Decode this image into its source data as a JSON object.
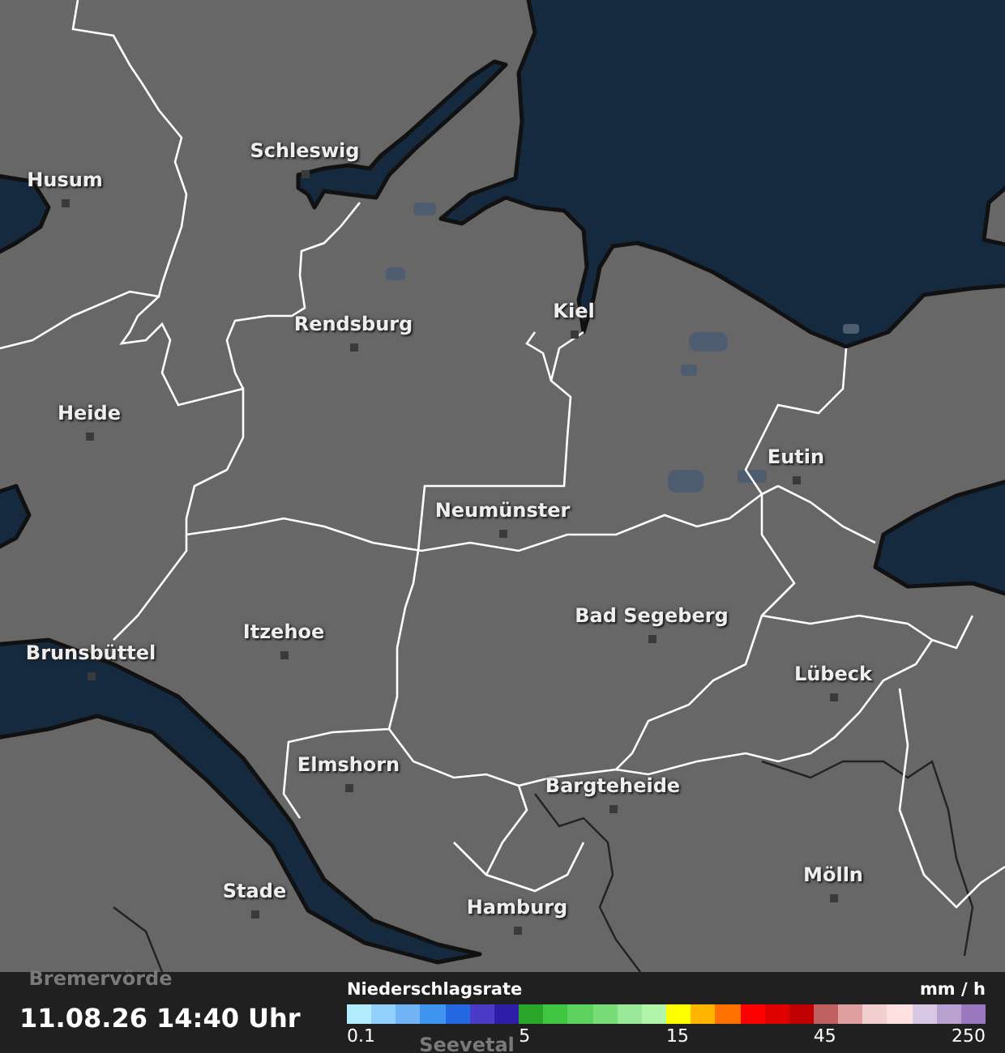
{
  "cities": [
    {
      "name": "Schleswig",
      "dimmed": false
    },
    {
      "name": "Husum",
      "dimmed": false
    },
    {
      "name": "Rendsburg",
      "dimmed": false
    },
    {
      "name": "Kiel",
      "dimmed": false
    },
    {
      "name": "Heide",
      "dimmed": false
    },
    {
      "name": "Eutin",
      "dimmed": false
    },
    {
      "name": "Neumünster",
      "dimmed": false
    },
    {
      "name": "Bad Segeberg",
      "dimmed": false
    },
    {
      "name": "Itzehoe",
      "dimmed": false
    },
    {
      "name": "Brunsbüttel",
      "dimmed": false
    },
    {
      "name": "Lübeck",
      "dimmed": false
    },
    {
      "name": "Elmshorn",
      "dimmed": false
    },
    {
      "name": "Bargteheide",
      "dimmed": false
    },
    {
      "name": "Stade",
      "dimmed": false
    },
    {
      "name": "Hamburg",
      "dimmed": false
    },
    {
      "name": "Mölln",
      "dimmed": false
    },
    {
      "name": "Bremervörde",
      "dimmed": true
    },
    {
      "name": "Seevetal",
      "dimmed": true
    }
  ],
  "timestamp": "11.08.26 14:40 Uhr",
  "legend": {
    "title": "Niederschlagsrate",
    "unit": "mm / h",
    "end_tick": "250",
    "swatches": [
      {
        "color": "#b4ecff",
        "tick": "0.1"
      },
      {
        "color": "#90d0fa"
      },
      {
        "color": "#70b4f6"
      },
      {
        "color": "#3e94ee"
      },
      {
        "color": "#2368e0"
      },
      {
        "color": "#4a3cc8"
      },
      {
        "color": "#2c1ea6"
      },
      {
        "color": "#2aa62a",
        "tick": "5"
      },
      {
        "color": "#40c640"
      },
      {
        "color": "#5ed25e"
      },
      {
        "color": "#78dc78"
      },
      {
        "color": "#98e898"
      },
      {
        "color": "#b0f5a8"
      },
      {
        "color": "#ffff00",
        "tick": "15"
      },
      {
        "color": "#ffb400"
      },
      {
        "color": "#ff7000"
      },
      {
        "color": "#ff0000"
      },
      {
        "color": "#e00000"
      },
      {
        "color": "#c00000"
      },
      {
        "color": "#c06060",
        "tick": "45"
      },
      {
        "color": "#e0a0a0"
      },
      {
        "color": "#f2d0d0"
      },
      {
        "color": "#ffe0e0"
      },
      {
        "color": "#d8c8e6"
      },
      {
        "color": "#b8a0d0"
      },
      {
        "color": "#9a78c0"
      }
    ]
  }
}
